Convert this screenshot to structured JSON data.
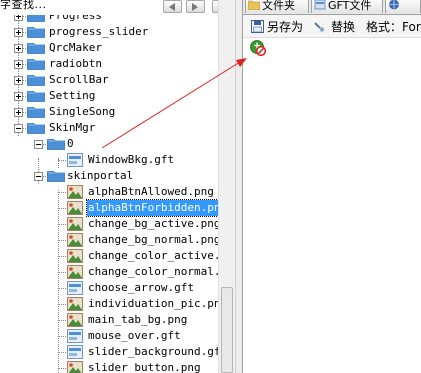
{
  "header": {
    "search_label": "字查找..."
  },
  "tree": {
    "items": [
      {
        "label": "Progress",
        "type": "folder",
        "expander": "plus",
        "level": 1
      },
      {
        "label": "progress_slider",
        "type": "folder",
        "expander": "plus",
        "level": 1
      },
      {
        "label": "QrcMaker",
        "type": "folder",
        "expander": "plus",
        "level": 1
      },
      {
        "label": "radiobtn",
        "type": "folder",
        "expander": "plus",
        "level": 1
      },
      {
        "label": "ScrollBar",
        "type": "folder",
        "expander": "plus",
        "level": 1
      },
      {
        "label": "Setting",
        "type": "folder",
        "expander": "plus",
        "level": 1
      },
      {
        "label": "SingleSong",
        "type": "folder",
        "expander": "plus",
        "level": 1
      },
      {
        "label": "SkinMgr",
        "type": "folder",
        "expander": "minus",
        "level": 1
      },
      {
        "label": "0",
        "type": "folder",
        "expander": "minus",
        "level": 2
      },
      {
        "label": "WindowBkg.gft",
        "type": "gft",
        "level": 3
      },
      {
        "label": "skinportal",
        "type": "folder",
        "expander": "minus",
        "level": 2
      },
      {
        "label": "alphaBtnAllowed.png",
        "type": "png",
        "level": 3
      },
      {
        "label": "alphaBtnForbidden.png",
        "type": "png",
        "level": 3,
        "selected": true
      },
      {
        "label": "change_bg_active.png",
        "type": "png",
        "level": 3
      },
      {
        "label": "change_bg_normal.png",
        "type": "png",
        "level": 3
      },
      {
        "label": "change_color_active.png",
        "type": "png",
        "level": 3
      },
      {
        "label": "change_color_normal.png",
        "type": "png",
        "level": 3
      },
      {
        "label": "choose_arrow.gft",
        "type": "gft",
        "level": 3
      },
      {
        "label": "individuation_pic.png",
        "type": "png",
        "level": 3
      },
      {
        "label": "main_tab_bg.png",
        "type": "png",
        "level": 3
      },
      {
        "label": "mouse_over.gft",
        "type": "gft",
        "level": 3
      },
      {
        "label": "slider_background.gft",
        "type": "gft",
        "level": 3
      },
      {
        "label": "slider_button.png",
        "type": "png",
        "level": 3
      }
    ]
  },
  "tabs": [
    {
      "label": "文件夹",
      "icon": "folder-icon"
    },
    {
      "label": "GFT文件",
      "icon": "gft-file-icon"
    },
    {
      "label": "",
      "icon": "globe-icon"
    }
  ],
  "toolbar": {
    "save_as": "另存为",
    "replace": "替换",
    "format_label": "格式：For"
  },
  "colors": {
    "selection": "#3399ff",
    "folder": "#4a8fd8",
    "arrow": "#e02020",
    "forbidden_badge": "#d42a2a",
    "green_icon": "#3a9b2c"
  }
}
